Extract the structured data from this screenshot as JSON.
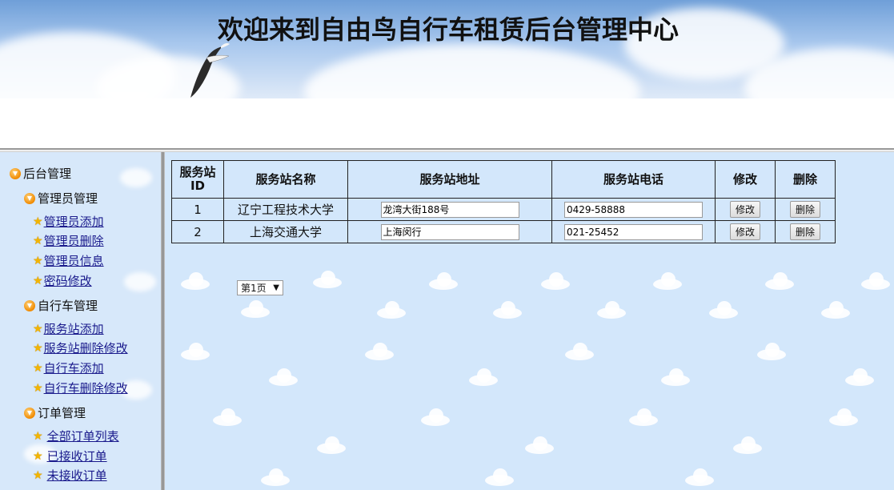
{
  "header": {
    "title": "欢迎来到自由鸟自行车租赁后台管理中心"
  },
  "sidebar": {
    "root": "后台管理",
    "groups": [
      {
        "label": "管理员管理",
        "items": [
          "管理员添加",
          "管理员删除",
          "管理员信息",
          "密码修改"
        ]
      },
      {
        "label": "自行车管理",
        "items": [
          "服务站添加",
          "服务站删除修改",
          "自行车添加",
          "自行车删除修改"
        ]
      },
      {
        "label": "订单管理",
        "items": [
          "全部订单列表",
          "已接收订单",
          "未接收订单"
        ]
      }
    ]
  },
  "table": {
    "headers": {
      "id": "服务站ID",
      "name": "服务站名称",
      "address": "服务站地址",
      "phone": "服务站电话",
      "edit": "修改",
      "delete": "删除"
    },
    "rows": [
      {
        "id": "1",
        "name": "辽宁工程技术大学",
        "address": "龙湾大街188号",
        "phone": "0429-58888",
        "edit_label": "修改",
        "delete_label": "删除"
      },
      {
        "id": "2",
        "name": "上海交通大学",
        "address": "上海闵行",
        "phone": "021-25452",
        "edit_label": "修改",
        "delete_label": "删除"
      }
    ]
  },
  "pager": {
    "selected": "第1页"
  },
  "icons": {
    "group": "circle-down-arrow-icon",
    "item": "star-icon"
  },
  "colors": {
    "link": "#1a1a8c",
    "panel_bg": "#d3e7fb",
    "sidebar_bg": "#d7e8fa"
  }
}
